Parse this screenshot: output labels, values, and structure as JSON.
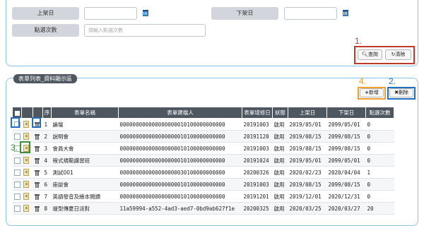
{
  "search": {
    "publish_date_label": "上架日",
    "unpublish_date_label": "下架日",
    "clicks_label": "點選次數",
    "clicks_placeholder": "請輸入點選次數",
    "query_button": "查詢",
    "clear_button": "清除"
  },
  "list": {
    "panel_title": "表單列表_資料顯示區",
    "add_button": "新增",
    "delete_button": "刪除",
    "columns": [
      "",
      "",
      "",
      "序",
      "表單名稱",
      "表單建檔人",
      "表單增修日",
      "狀態",
      "上架日",
      "下架日",
      "點選次數"
    ],
    "rows": [
      {
        "seq": "1",
        "name": "論壇",
        "creator": "000000000000000000010100000000000",
        "modified": "20191003",
        "status": "啟用",
        "start": "2019/05/01",
        "end": "2099/05/01",
        "clicks": "0"
      },
      {
        "seq": "2",
        "name": "說明會",
        "creator": "000000000000000000010100000000000",
        "modified": "20191120",
        "status": "啟用",
        "start": "2019/08/15",
        "end": "2099/08/15",
        "clicks": "0"
      },
      {
        "seq": "3",
        "name": "會員大會",
        "creator": "000000000000000000010100000000000",
        "modified": "20191003",
        "status": "啟用",
        "start": "2019/08/15",
        "end": "2099/08/15",
        "clicks": "0"
      },
      {
        "seq": "4",
        "name": "程式規範講習班",
        "creator": "000000000000000000010100000000000",
        "modified": "20191024",
        "status": "啟用",
        "start": "2019/05/01",
        "end": "2099/05/01",
        "clicks": "0"
      },
      {
        "seq": "5",
        "name": "測試001",
        "creator": "000000000000000000030100000000000",
        "modified": "20200326",
        "status": "啟用",
        "start": "2020/02/23",
        "end": "2020/04/04",
        "clicks": "1"
      },
      {
        "seq": "6",
        "name": "座談會",
        "creator": "000000000000000000010100000000000",
        "modified": "20191003",
        "status": "啟用",
        "start": "2019/08/15",
        "end": "2099/08/15",
        "clicks": "0"
      },
      {
        "seq": "7",
        "name": "英語發音及繪本閱讀",
        "creator": "000000000000000000010100000000000",
        "modified": "20191201",
        "status": "啟用",
        "start": "2019/12/01",
        "end": "2020/12/31",
        "clicks": "0"
      },
      {
        "seq": "8",
        "name": "堤型傳夏日派對",
        "creator": "11a59994-a552-4ad3-aed7-0bd9ab627f1e",
        "modified": "20200325",
        "status": "啟用",
        "start": "2020/03/25",
        "end": "2020/03/27",
        "clicks": "20"
      }
    ]
  },
  "annotations": {
    "n1": "1.",
    "n2": "2.",
    "n3": "3.",
    "n4": "4."
  },
  "icons": {
    "calendar": "calendar-icon",
    "search": "magnifier-icon",
    "clear": "refresh-icon",
    "add": "plus-icon",
    "delete": "x-icon",
    "edit": "pencil-document-icon",
    "trash": "trash-icon"
  },
  "colors": {
    "panel_border": "#8cc4e8",
    "header_bg": "#4e5660",
    "red_highlight": "#c0392b",
    "blue_highlight": "#1f6fc5",
    "green_highlight": "#3a8f3a",
    "orange_highlight": "#f0a030"
  }
}
